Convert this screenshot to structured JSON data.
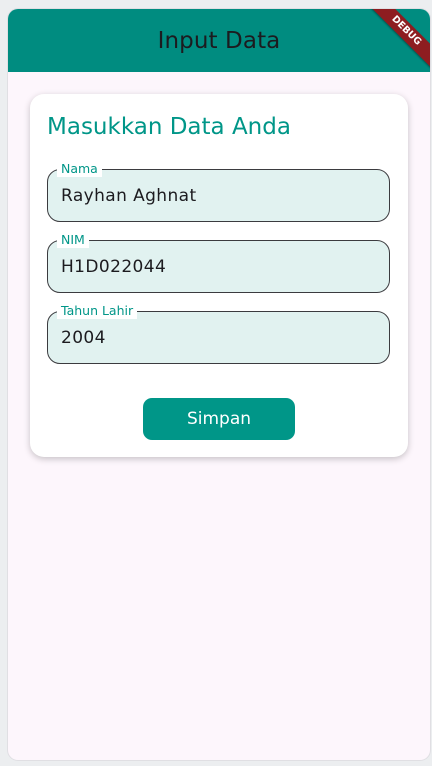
{
  "appbar": {
    "title": "Input Data",
    "color": "#008c80"
  },
  "debug_banner": {
    "label": "DEBUG"
  },
  "form": {
    "title": "Masukkan Data Anda",
    "fields": [
      {
        "label": "Nama",
        "value": "Rayhan Aghnat"
      },
      {
        "label": "NIM",
        "value": "H1D022044"
      },
      {
        "label": "Tahun Lahir",
        "value": "2004"
      }
    ],
    "save_label": "Simpan"
  },
  "colors": {
    "accent": "#009688",
    "field_fill": "#e1f2f0",
    "background": "#fdf6fc"
  }
}
